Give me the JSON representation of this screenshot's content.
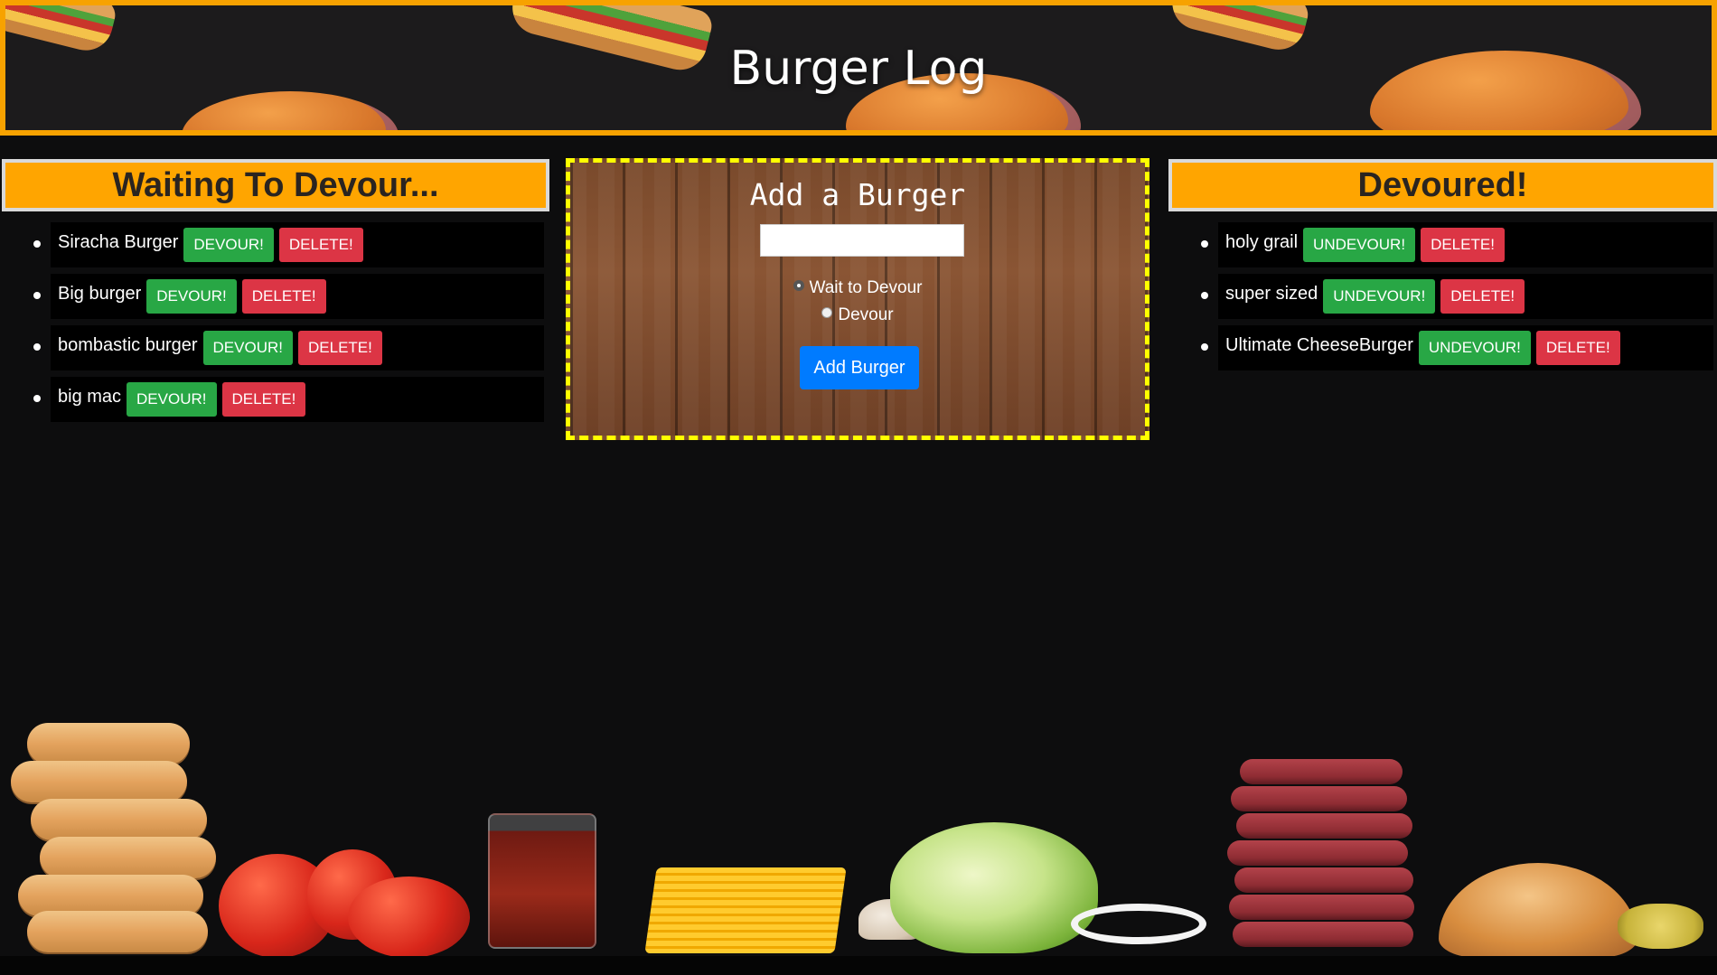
{
  "header": {
    "title": "Burger Log"
  },
  "waiting": {
    "title": "Waiting To Devour...",
    "items": [
      {
        "name": "Siracha Burger",
        "devour_label": "DEVOUR!",
        "delete_label": "DELETE!"
      },
      {
        "name": "Big burger",
        "devour_label": "DEVOUR!",
        "delete_label": "DELETE!"
      },
      {
        "name": "bombastic burger",
        "devour_label": "DEVOUR!",
        "delete_label": "DELETE!"
      },
      {
        "name": "big mac",
        "devour_label": "DEVOUR!",
        "delete_label": "DELETE!"
      }
    ]
  },
  "add_form": {
    "title": "Add a Burger",
    "input_value": "",
    "radio_wait_label": "Wait to Devour",
    "radio_devour_label": "Devour",
    "selected_radio": "wait",
    "submit_label": "Add Burger"
  },
  "devoured": {
    "title": "Devoured!",
    "items": [
      {
        "name": "holy grail",
        "undevour_label": "UNDEVOUR!",
        "delete_label": "DELETE!"
      },
      {
        "name": "super sized",
        "undevour_label": "UNDEVOUR!",
        "delete_label": "DELETE!"
      },
      {
        "name": "Ultimate CheeseBurger",
        "undevour_label": "UNDEVOUR!",
        "delete_label": "DELETE!"
      }
    ]
  },
  "colors": {
    "header_border": "#f7a200",
    "panel_title_bg": "#ffa500",
    "add_box_border": "#ffff00",
    "devour_button": "#28a745",
    "delete_button": "#dc3545",
    "add_button": "#007bff"
  }
}
